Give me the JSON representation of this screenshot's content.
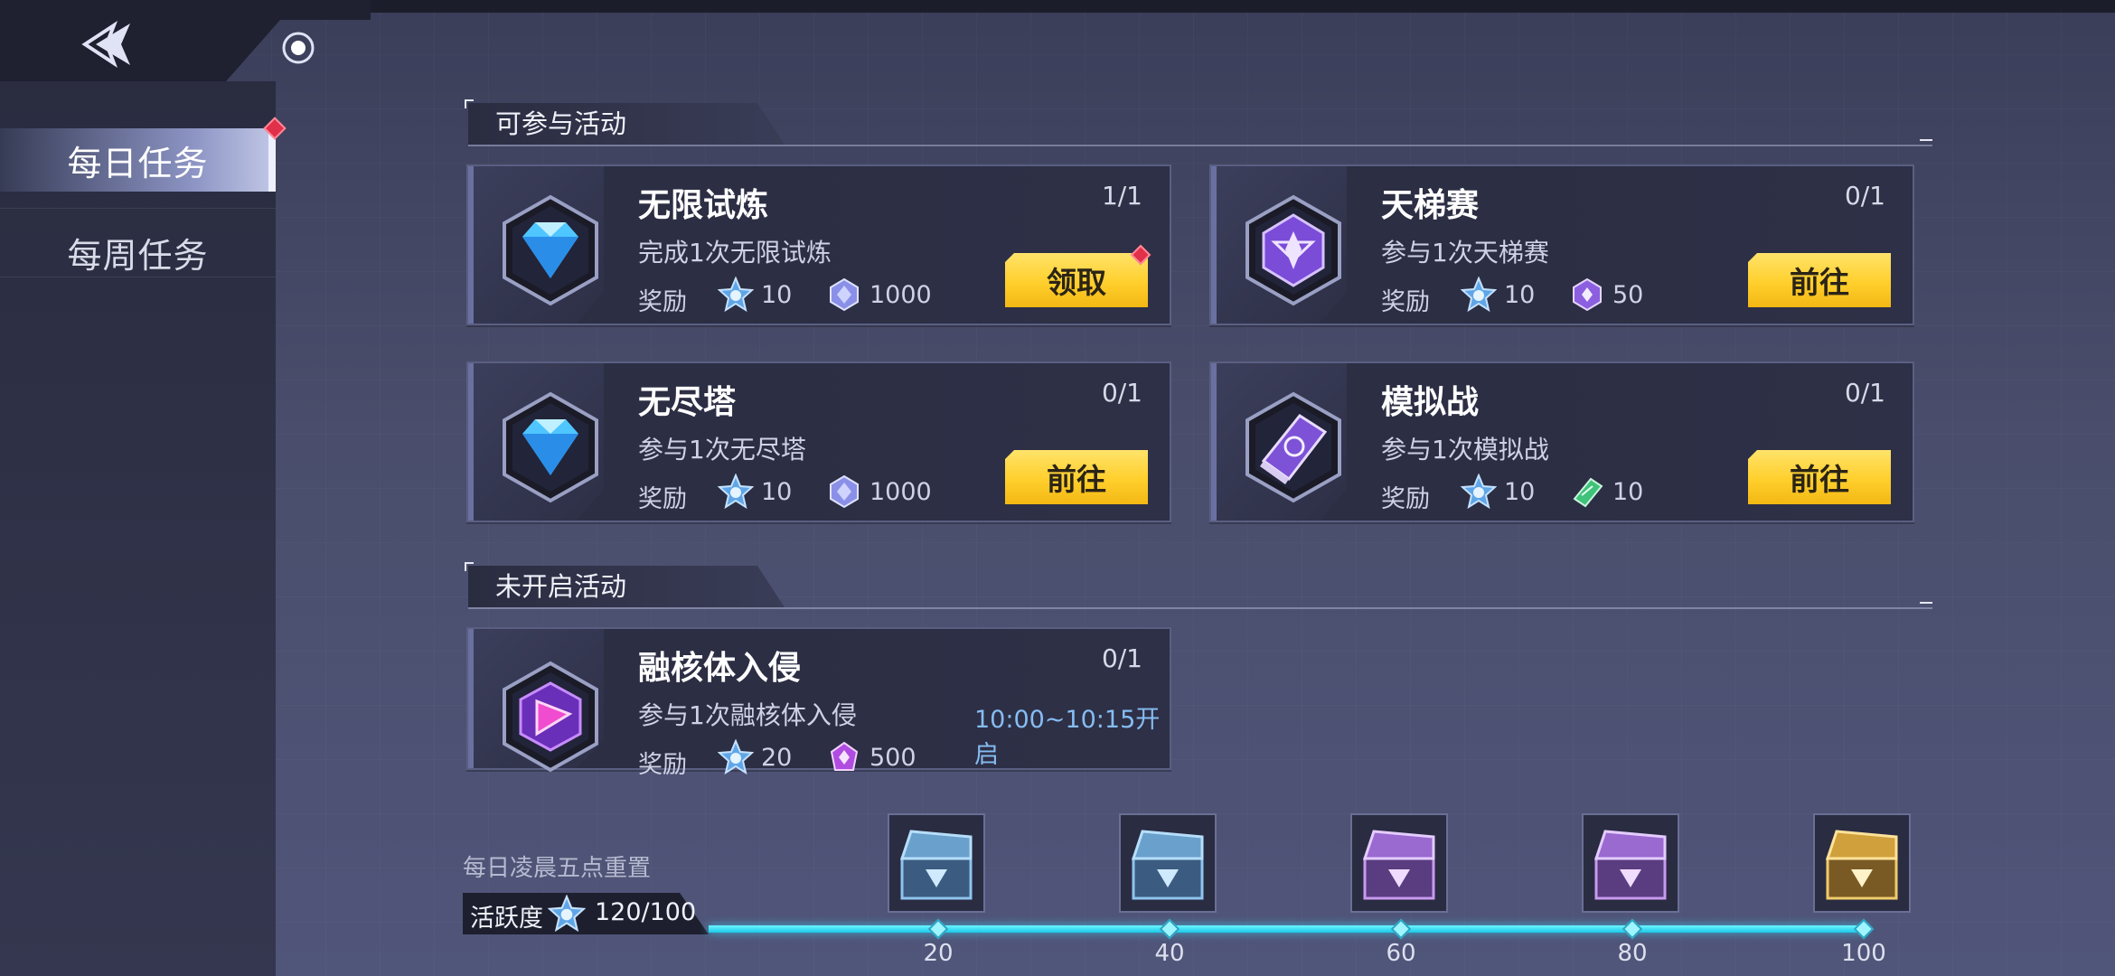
{
  "header": {
    "back_icon": "back-arrow-icon",
    "record_icon": "record-icon"
  },
  "sidebar": {
    "items": [
      {
        "label": "每日任务",
        "active": true,
        "badge": true
      },
      {
        "label": "每周任务",
        "active": false,
        "badge": false
      }
    ]
  },
  "sections": {
    "available": "可参与活动",
    "locked": "未开启活动"
  },
  "tasks": [
    {
      "title": "无限试炼",
      "progress": "1/1",
      "desc": "完成1次无限试炼",
      "reward_label": "奖励",
      "reward1": "10",
      "reward1_icon": "activity-point-icon",
      "reward2": "1000",
      "reward2_icon": "purple-gem-icon",
      "button": "领取",
      "icon": "diamond-icon",
      "badge": true
    },
    {
      "title": "天梯赛",
      "progress": "0/1",
      "desc": "参与1次天梯赛",
      "reward_label": "奖励",
      "reward1": "10",
      "reward1_icon": "activity-point-icon",
      "reward2": "50",
      "reward2_icon": "ladder-coin-icon",
      "button": "前往",
      "icon": "ladder-emblem-icon"
    },
    {
      "title": "无尽塔",
      "progress": "0/1",
      "desc": "参与1次无尽塔",
      "reward_label": "奖励",
      "reward1": "10",
      "reward1_icon": "activity-point-icon",
      "reward2": "1000",
      "reward2_icon": "purple-gem-icon",
      "button": "前往",
      "icon": "diamond-icon"
    },
    {
      "title": "模拟战",
      "progress": "0/1",
      "desc": "参与1次模拟战",
      "reward_label": "奖励",
      "reward1": "10",
      "reward1_icon": "activity-point-icon",
      "reward2": "10",
      "reward2_icon": "green-ticket-icon",
      "button": "前往",
      "icon": "simulation-book-icon"
    }
  ],
  "locked_tasks": [
    {
      "title": "融核体入侵",
      "progress": "0/1",
      "desc": "参与1次融核体入侵",
      "time": "10:00~10:15开启",
      "reward_label": "奖励",
      "reward1": "20",
      "reward1_icon": "activity-point-icon",
      "reward2": "500",
      "reward2_icon": "purple-crystal-icon",
      "icon": "fusion-core-icon"
    }
  ],
  "activity": {
    "reset_note": "每日凌晨五点重置",
    "label": "活跃度",
    "value": "120/100",
    "progress_fraction": 1.0,
    "milestones": [
      {
        "label": "20",
        "chest": "blue-chest-icon"
      },
      {
        "label": "40",
        "chest": "blue-chest-icon"
      },
      {
        "label": "60",
        "chest": "purple-chest-icon"
      },
      {
        "label": "80",
        "chest": "purple-chest-icon"
      },
      {
        "label": "100",
        "chest": "gold-chest-icon"
      }
    ]
  },
  "colors": {
    "button": "#ffd23a",
    "accent_cyan": "#3cdcff",
    "badge_red": "#e0304a",
    "time_blue": "#86bdf2"
  }
}
